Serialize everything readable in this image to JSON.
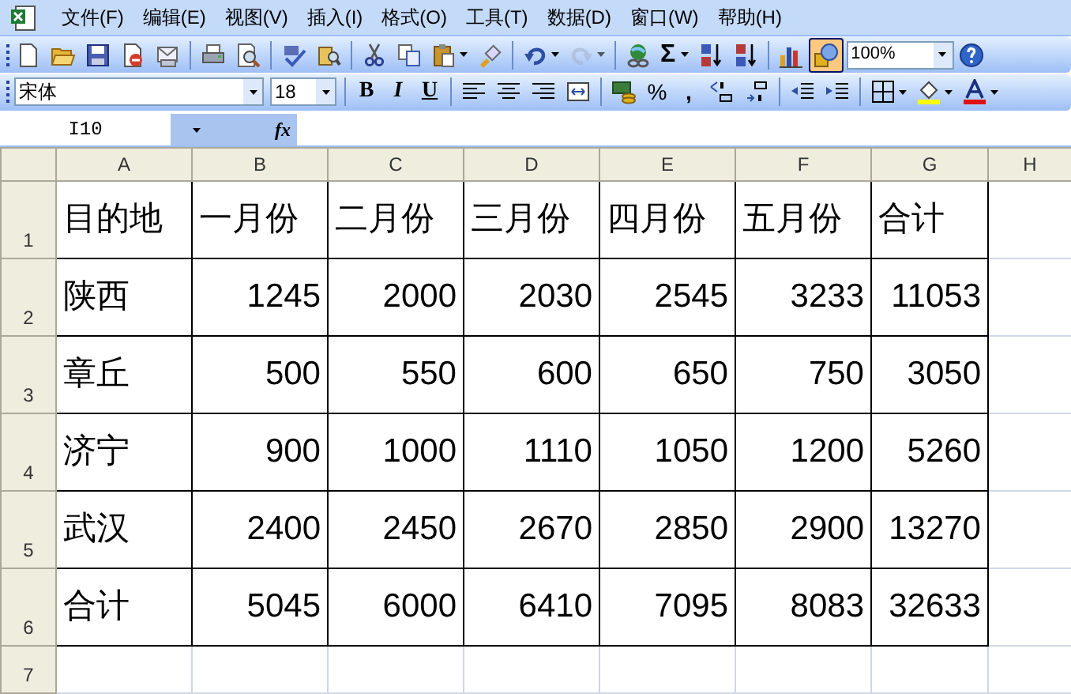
{
  "menu": [
    {
      "label": "文件(F)"
    },
    {
      "label": "编辑(E)"
    },
    {
      "label": "视图(V)"
    },
    {
      "label": "插入(I)"
    },
    {
      "label": "格式(O)"
    },
    {
      "label": "工具(T)"
    },
    {
      "label": "数据(D)"
    },
    {
      "label": "窗口(W)"
    },
    {
      "label": "帮助(H)"
    }
  ],
  "standard_toolbar": {
    "sum_glyph": "Σ",
    "redo_enabled": false,
    "drawing_pressed": true,
    "zoom": "100%"
  },
  "formatting_toolbar": {
    "font": "宋体",
    "size": "18",
    "bold": "B",
    "italic": "I",
    "underline": "U",
    "percent": "%",
    "comma": ","
  },
  "formula_bar": {
    "name_box": "I10",
    "function_label": "fx"
  },
  "sheet": {
    "columns": [
      "A",
      "B",
      "C",
      "D",
      "E",
      "F",
      "G",
      "H"
    ],
    "rows": [
      {
        "number": "1",
        "cells": [
          "目的地",
          "一月份",
          "二月份",
          "三月份",
          "四月份",
          "五月份",
          "合计"
        ]
      },
      {
        "number": "2",
        "cells": [
          "陕西",
          "1245",
          "2000",
          "2030",
          "2545",
          "3233",
          "11053"
        ]
      },
      {
        "number": "3",
        "cells": [
          "章丘",
          "500",
          "550",
          "600",
          "650",
          "750",
          "3050"
        ]
      },
      {
        "number": "4",
        "cells": [
          "济宁",
          "900",
          "1000",
          "1110",
          "1050",
          "1200",
          "5260"
        ]
      },
      {
        "number": "5",
        "cells": [
          "武汉",
          "2400",
          "2450",
          "2670",
          "2850",
          "2900",
          "13270"
        ]
      },
      {
        "number": "6",
        "cells": [
          "合计",
          "5045",
          "6000",
          "6410",
          "7095",
          "8083",
          "32633"
        ]
      },
      {
        "number": "7",
        "cells": []
      }
    ]
  }
}
